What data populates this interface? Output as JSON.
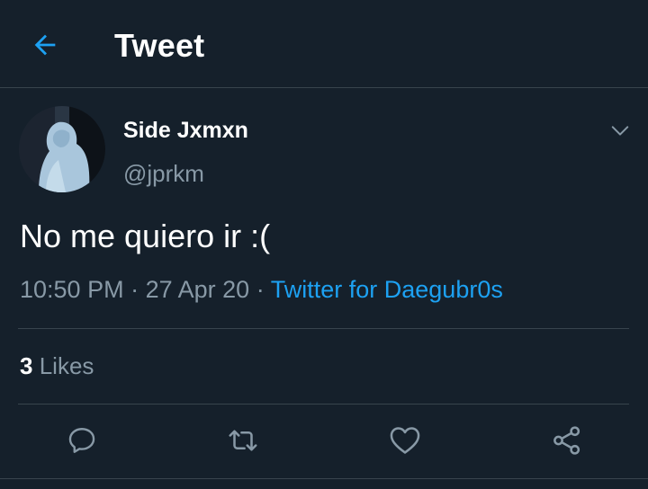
{
  "header": {
    "title": "Tweet",
    "back_icon": "arrow-left-icon"
  },
  "tweet": {
    "author_name": "Side Jxmxn",
    "author_handle": "@jprkm",
    "text": "No me quiero ir :(",
    "time": "10:50 PM",
    "separator": "·",
    "date": "27 Apr 20",
    "source": "Twitter for Daegubr0s",
    "likes_count": "3",
    "likes_label": "Likes"
  },
  "actions": [
    {
      "name": "reply",
      "icon": "reply-icon"
    },
    {
      "name": "retweet",
      "icon": "retweet-icon"
    },
    {
      "name": "like",
      "icon": "heart-icon"
    },
    {
      "name": "share",
      "icon": "share-icon"
    }
  ],
  "colors": {
    "background": "#15202b",
    "accent": "#1da1f2",
    "secondary_text": "#8899a6",
    "divider": "#38444d"
  }
}
